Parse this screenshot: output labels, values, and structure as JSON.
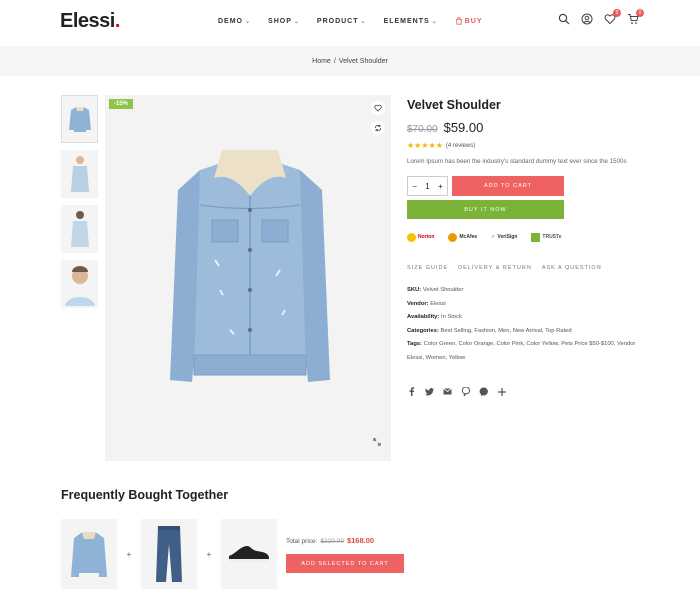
{
  "header": {
    "logo": "Elessi",
    "logo_dot": ".",
    "nav": [
      {
        "label": "DEMO",
        "chevron": true
      },
      {
        "label": "SHOP",
        "chevron": true
      },
      {
        "label": "PRODUCT",
        "chevron": true
      },
      {
        "label": "ELEMENTS",
        "chevron": true
      },
      {
        "label": "BUY",
        "chevron": false
      }
    ],
    "wishlist_count": "0",
    "cart_count": "0"
  },
  "breadcrumb": {
    "home": "Home",
    "sep": "/",
    "current": "Velvet Shoulder"
  },
  "product": {
    "sale_badge": "-15%",
    "title": "Velvet Shoulder",
    "old_price": "$70.00",
    "price": "$59.00",
    "stars": "★★★★★",
    "reviews": "(4 reviews)",
    "description": "Lorem Ipsum has been the industry's standard dummy text ever since the 1500s",
    "qty": "1",
    "add_to_cart": "ADD TO CART",
    "buy_now": "BUY IT NOW",
    "trust": [
      "Norton",
      "McAfee",
      "VeriSign",
      "TRUSTe"
    ],
    "links": [
      "SIZE GUIDE",
      "DELIVERY & RETURN",
      "ASK A QUESTION"
    ],
    "meta": {
      "sku_label": "SKU:",
      "sku": "Velvet Shoulder",
      "vendor_label": "Vendor:",
      "vendor": "Elessi",
      "availability_label": "Availability:",
      "availability": "In Stock",
      "categories_label": "Categories:",
      "categories": "Best Selling, Fashion, Men, New Arrival, Top Rated",
      "tags_label": "Tags:",
      "tags": "Color Green, Color Orange, Color Pink, Color Yellow, Pets Price $50-$100, Vendor Elessi, Women, Yellow"
    }
  },
  "fbt": {
    "title": "Frequently Bought Together",
    "total_label": "Total price:",
    "total_old": "$220.00",
    "total_new": "$168.00",
    "button": "ADD SELECTED TO CART"
  },
  "colors": {
    "accent_red": "#ef6262",
    "accent_green": "#7ab338",
    "badge_green": "#8fc34a",
    "star": "#f5b300"
  }
}
